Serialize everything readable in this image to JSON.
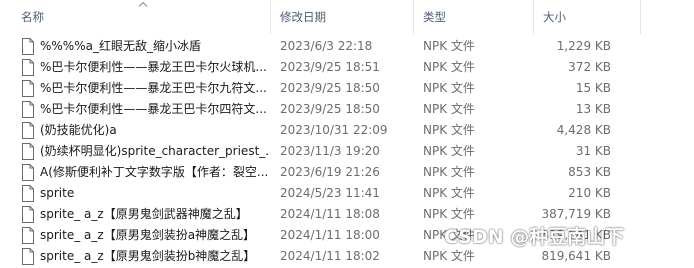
{
  "columns": {
    "name": "名称",
    "date": "修改日期",
    "type": "类型",
    "size": "大小"
  },
  "files": [
    {
      "name": "%%%%a_红眼无敌_缩小冰盾",
      "date": "2023/6/3 22:18",
      "type": "NPK 文件",
      "size": "1,229 KB",
      "icon": "file-icon"
    },
    {
      "name": "%巴卡尔便利性——暴龙王巴卡尔火球机...",
      "date": "2023/9/25 18:51",
      "type": "NPK 文件",
      "size": "372 KB",
      "icon": "file-icon"
    },
    {
      "name": "%巴卡尔便利性——暴龙王巴卡尔九符文...",
      "date": "2023/9/25 18:50",
      "type": "NPK 文件",
      "size": "15 KB",
      "icon": "file-icon"
    },
    {
      "name": "%巴卡尔便利性——暴龙王巴卡尔四符文...",
      "date": "2023/9/25 18:50",
      "type": "NPK 文件",
      "size": "13 KB",
      "icon": "file-icon"
    },
    {
      "name": "(奶技能优化)a",
      "date": "2023/10/31 22:09",
      "type": "NPK 文件",
      "size": "4,428 KB",
      "icon": "file-icon"
    },
    {
      "name": "(奶续杯明显化)sprite_character_priest_...",
      "date": "2023/11/3 19:20",
      "type": "NPK 文件",
      "size": "31 KB",
      "icon": "file-icon"
    },
    {
      "name": "A(修斯便利补丁文字数字版【作者：裂空...",
      "date": "2023/6/19 21:26",
      "type": "NPK 文件",
      "size": "853 KB",
      "icon": "file-icon"
    },
    {
      "name": "sprite",
      "date": "2024/5/23 11:41",
      "type": "NPK 文件",
      "size": "210 KB",
      "icon": "file-icon"
    },
    {
      "name": "sprite_ a_z【原男鬼剑武器神魔之乱】",
      "date": "2024/1/11 18:08",
      "type": "NPK 文件",
      "size": "387,719 KB",
      "icon": "file-icon"
    },
    {
      "name": "sprite_ a_z【原男鬼剑装扮a神魔之乱】",
      "date": "2024/1/11 18:00",
      "type": "NPK 文件",
      "size": "819,641 KB",
      "icon": "file-icon"
    },
    {
      "name": "sprite_ a_z【原男鬼剑装扮b神魔之乱】",
      "date": "2024/1/11 18:02",
      "type": "NPK 文件",
      "size": "819,641 KB",
      "icon": "file-icon"
    }
  ],
  "watermark": "CSDN @种豆南山下",
  "colors": {
    "header_text": "#4c607a",
    "secondary_text": "#6d6d6d",
    "primary_text": "#1a1a1a"
  }
}
